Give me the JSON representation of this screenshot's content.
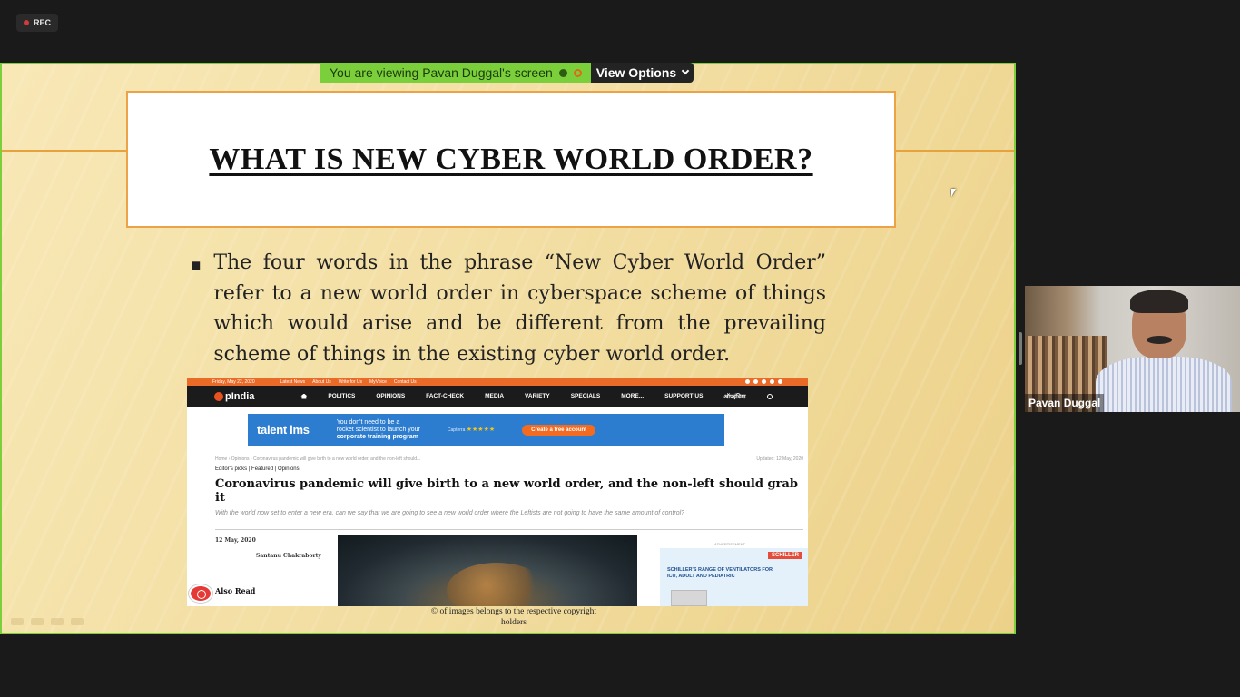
{
  "recording": {
    "label": "REC"
  },
  "share_bar": {
    "viewing_text": "You are viewing Pavan Duggal's screen",
    "view_options": "View Options"
  },
  "slide": {
    "title": "WHAT IS NEW CYBER WORLD ORDER?",
    "bullet": "The four words in the phrase “New Cyber World Order” refer to a new world order in cyberspace scheme of things which would arise and be different from the prevailing scheme of things in the existing cyber world order.",
    "caption": "© of images belongs to the respective copyright holders"
  },
  "article": {
    "topbar_date": "Friday, May 22, 2020",
    "topbar_links": [
      "Latest News",
      "About Us",
      "Write for Us",
      "MyVoice",
      "Contact Us"
    ],
    "logo": "pIndia",
    "nav": [
      "POLITICS",
      "OPINIONS",
      "FACT-CHECK",
      "MEDIA",
      "VARIETY",
      "SPECIALS",
      "MORE...",
      "SUPPORT US",
      "ऑपइंडिया"
    ],
    "ad": {
      "brand": "talent lms",
      "line1": "You don't need to be a",
      "line2": "rocket scientist to launch your",
      "line3": "corporate training program",
      "capterra": "Capterra",
      "stars": "★★★★★",
      "cta": "Create a free account"
    },
    "breadcrumb": "Home › Opinions › Coronavirus pandemic will give birth to a new world order, and the non-left should...",
    "updated": "Updated: 12 May, 2020",
    "tags": "Editor's picks  |  Featured  |  Opinions",
    "headline": "Coronavirus pandemic will give birth to a new world order, and the non-left should grab it",
    "subheadline": "With the world now set to enter a new era, can we say that we are going to see a new world order where the Leftists are not going to have the same amount of control?",
    "date": "12 May, 2020",
    "author": "Santanu Chakraborty",
    "also_read": "Also Read",
    "side_ad_label": "ADVERTISEMENT",
    "side_ad_brand": "SCHILLER",
    "side_ad_text": "SCHILLER'S RANGE OF VENTILATORS FOR ICU, ADULT AND PEDIATRIC"
  },
  "video": {
    "participant_name": "Pavan Duggal"
  },
  "colors": {
    "share_border": "#7bcf3a",
    "title_border": "#eca246",
    "opindia_orange": "#ea6a28"
  }
}
